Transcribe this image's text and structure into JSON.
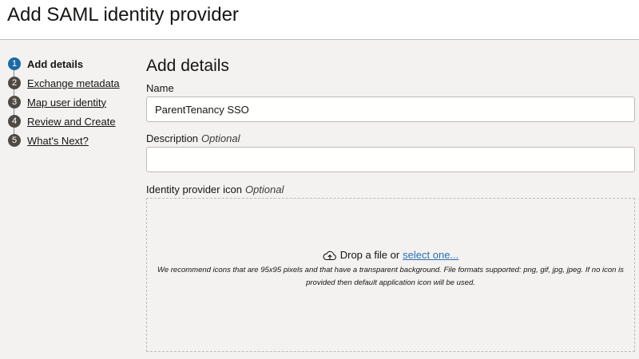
{
  "header": {
    "title": "Add SAML identity provider"
  },
  "steps": [
    {
      "number": "1",
      "label": "Add details"
    },
    {
      "number": "2",
      "label": "Exchange metadata"
    },
    {
      "number": "3",
      "label": "Map user identity"
    },
    {
      "number": "4",
      "label": "Review and Create"
    },
    {
      "number": "5",
      "label": "What's Next?"
    }
  ],
  "main": {
    "section_title": "Add details",
    "name": {
      "label": "Name",
      "value": "ParentTenancy SSO"
    },
    "description": {
      "label": "Description",
      "optional": "Optional",
      "value": ""
    },
    "icon": {
      "label": "Identity provider icon",
      "optional": "Optional",
      "drop_text": "Drop a file or",
      "select_link": "select one...",
      "hint": "We recommend icons that are 95x95 pixels and that have a transparent background. File formats supported: png, gif, jpg, jpeg. If no icon is provided then default application icon will be used.",
      "icon_name": "upload-cloud-icon"
    }
  },
  "colors": {
    "active_step": "#1a6aa4",
    "inactive_step": "#4f4a45",
    "link": "#2a6fb0"
  }
}
